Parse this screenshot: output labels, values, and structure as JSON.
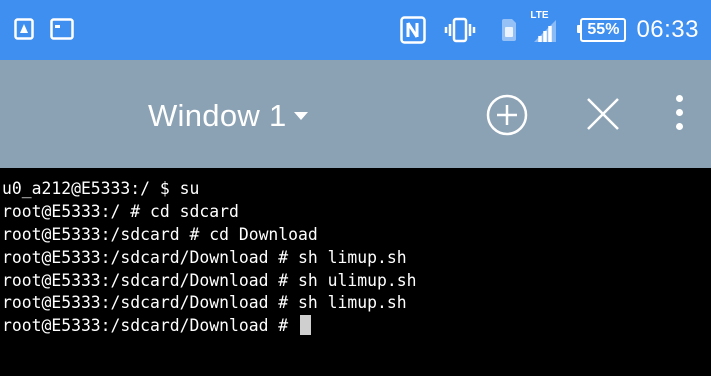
{
  "status_bar": {
    "icons_left": [
      "screenshot-icon",
      "cast-icon"
    ],
    "icons_right": [
      "nfc-icon",
      "vibrate-icon",
      "sim-icon",
      "signal-icon"
    ],
    "network_type": "LTE",
    "battery": "55%",
    "time": "06:33",
    "background_color": "#3f8ff0"
  },
  "app_bar": {
    "window_title": "Window 1",
    "actions": [
      "add-window",
      "close-window",
      "overflow-menu"
    ],
    "background_color": "#8ba1b4"
  },
  "terminal": {
    "lines": [
      "u0_a212@E5333:/ $ su",
      "root@E5333:/ # cd sdcard",
      "root@E5333:/sdcard # cd Download",
      "root@E5333:/sdcard/Download # sh limup.sh",
      "root@E5333:/sdcard/Download # sh ulimup.sh",
      "root@E5333:/sdcard/Download # sh limup.sh",
      "root@E5333:/sdcard/Download # "
    ]
  }
}
